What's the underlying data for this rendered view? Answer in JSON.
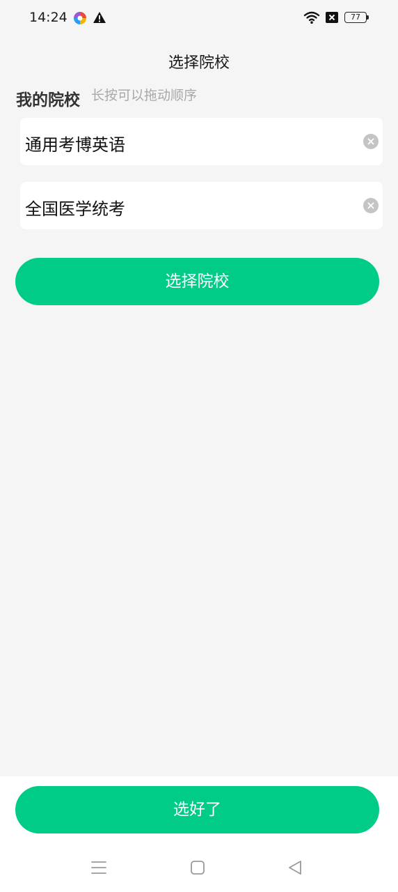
{
  "status_bar": {
    "time": "14:24",
    "battery_level": "77",
    "icons": [
      "app-notification-icon",
      "warning-icon",
      "wifi-icon",
      "sim-disabled-icon",
      "battery-icon"
    ]
  },
  "header": {
    "title": "选择院校"
  },
  "my_schools": {
    "title": "我的院校",
    "hint": "长按可以拖动顺序",
    "items": [
      {
        "name": "通用考博英语"
      },
      {
        "name": "全国医学统考"
      }
    ]
  },
  "select_button_label": "选择院校",
  "done_button_label": "选好了",
  "nav_bar": {
    "icons": [
      "menu-icon",
      "home-icon",
      "back-icon"
    ]
  },
  "colors": {
    "accent": "#00cc88",
    "background": "#f5f5f5",
    "card": "#ffffff",
    "hint_text": "#a8a8a8"
  }
}
